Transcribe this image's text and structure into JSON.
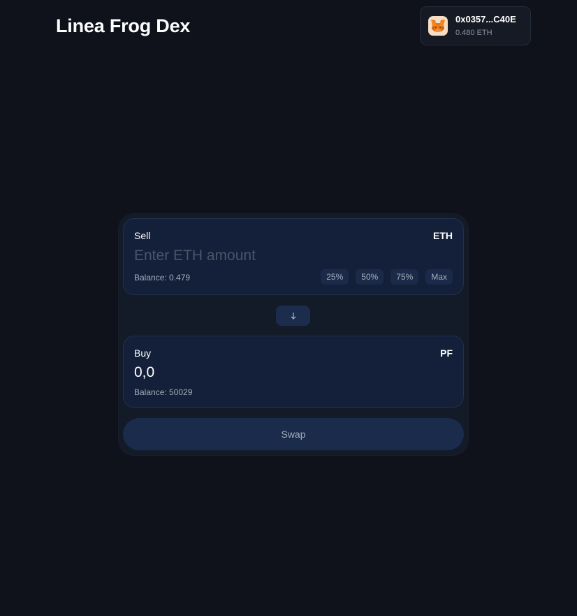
{
  "header": {
    "title": "Linea Frog Dex"
  },
  "wallet": {
    "icon": "metamask-fox-icon",
    "address": "0x0357...C40E",
    "balance": "0.480 ETH"
  },
  "swap": {
    "sell": {
      "label": "Sell",
      "token": "ETH",
      "input_value": "",
      "input_placeholder": "Enter ETH amount",
      "balance": "Balance: 0.479",
      "percent_buttons": [
        "25%",
        "50%",
        "75%",
        "Max"
      ]
    },
    "flip_icon": "arrow-down-icon",
    "buy": {
      "label": "Buy",
      "token": "PF",
      "amount": "0,0",
      "balance": "Balance: 50029"
    },
    "submit_label": "Swap"
  },
  "colors": {
    "background": "#0f121a",
    "card": "#131a28",
    "panel": "#14203a",
    "button": "#1a2b4c",
    "muted_text": "#a5adbb"
  }
}
